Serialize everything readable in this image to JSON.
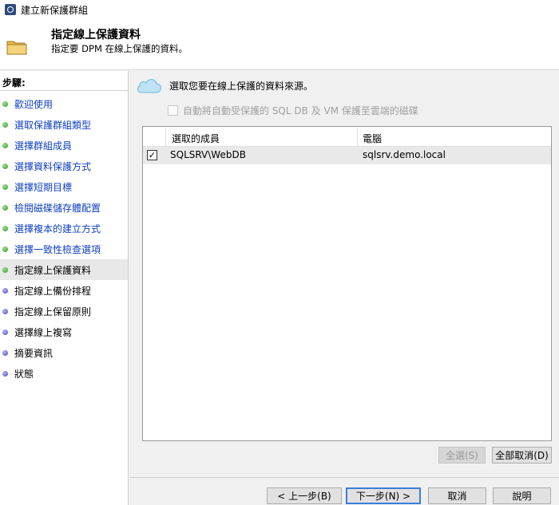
{
  "window": {
    "title": "建立新保護群組"
  },
  "header": {
    "title": "指定線上保護資料",
    "subtitle": "指定要 DPM 在線上保護的資料。"
  },
  "steps": {
    "title": "步驟:",
    "items": [
      {
        "label": "歡迎使用",
        "state": "done"
      },
      {
        "label": "選取保護群組類型",
        "state": "done"
      },
      {
        "label": "選擇群組成員",
        "state": "done"
      },
      {
        "label": "選擇資料保護方式",
        "state": "done"
      },
      {
        "label": "選擇短期目標",
        "state": "done"
      },
      {
        "label": "檢閱磁碟儲存體配置",
        "state": "done"
      },
      {
        "label": "選擇複本的建立方式",
        "state": "done"
      },
      {
        "label": "選擇一致性檢查選項",
        "state": "done"
      },
      {
        "label": "指定線上保護資料",
        "state": "current"
      },
      {
        "label": "指定線上備份排程",
        "state": "todo"
      },
      {
        "label": "指定線上保留原則",
        "state": "todo"
      },
      {
        "label": "選擇線上複寫",
        "state": "todo"
      },
      {
        "label": "摘要資訊",
        "state": "todo"
      },
      {
        "label": "狀態",
        "state": "todo"
      }
    ]
  },
  "content": {
    "heading": "選取您要在線上保護的資料來源。",
    "auto_protect_label": "自動將自動受保護的 SQL DB 及 VM 保護至雲端的磁碟",
    "grid": {
      "columns": [
        "選取的成員",
        "電腦"
      ],
      "rows": [
        {
          "checked": true,
          "member": "SQLSRV\\WebDB",
          "computer": "sqlsrv.demo.local"
        }
      ]
    },
    "select_all_label": "全選(S)",
    "clear_all_label": "全部取消(D)"
  },
  "footer": {
    "back_label": "< 上一步(B)",
    "next_label": "下一步(N) >",
    "cancel_label": "取消",
    "help_label": "說明"
  },
  "colors": {
    "step_done_link": "#1040c0",
    "dot_done": "#2f9a2a",
    "dot_todo": "#4a4ab8",
    "primary_border": "#3b7dd8"
  },
  "icons": {
    "window": "dpm-app-icon",
    "header": "folder-icon",
    "content": "cloud-icon"
  }
}
